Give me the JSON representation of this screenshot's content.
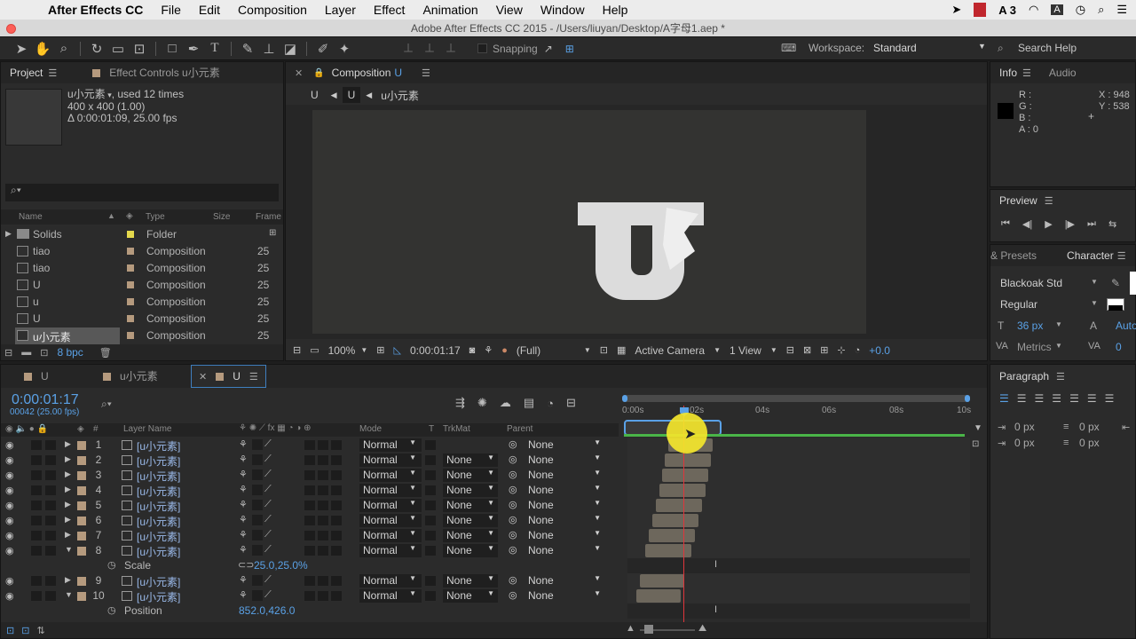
{
  "menubar": {
    "app": "After Effects CC",
    "items": [
      "File",
      "Edit",
      "Composition",
      "Layer",
      "Effect",
      "Animation",
      "View",
      "Window",
      "Help"
    ],
    "status_badge": "3"
  },
  "titlebar": {
    "title": "Adobe After Effects CC 2015 - /Users/liuyan/Desktop/A字母1.aep *"
  },
  "toolbar": {
    "snapping": "Snapping",
    "workspace_label": "Workspace:",
    "workspace_value": "Standard",
    "search_placeholder": "Search Help"
  },
  "project": {
    "tab_project": "Project",
    "tab_effects": "Effect Controls u小元素",
    "item_name": "u小元素",
    "item_used": ", used 12 times",
    "item_dims": "400 x 400 (1.00)",
    "item_duration": "Δ 0:00:01:09, 25.00 fps",
    "cols": {
      "name": "Name",
      "type": "Type",
      "size": "Size",
      "frame": "Frame"
    },
    "rows": [
      {
        "name": "Solids",
        "type": "Folder",
        "frame": "",
        "folder": true
      },
      {
        "name": "tiao",
        "type": "Composition",
        "frame": "25"
      },
      {
        "name": "tiao",
        "type": "Composition",
        "frame": "25"
      },
      {
        "name": "U",
        "type": "Composition",
        "frame": "25"
      },
      {
        "name": "u",
        "type": "Composition",
        "frame": "25"
      },
      {
        "name": "U",
        "type": "Composition",
        "frame": "25"
      },
      {
        "name": "u小元素",
        "type": "Composition",
        "frame": "25",
        "selected": true
      }
    ],
    "bpc": "8 bpc"
  },
  "composition": {
    "tab_label": "Composition",
    "tab_name": "U",
    "crumbs": [
      "U",
      "U",
      "u小元素"
    ],
    "letter": "U",
    "zoom": "100%",
    "timecode": "0:00:01:17",
    "resolution": "(Full)",
    "camera": "Active Camera",
    "views": "1 View",
    "exposure": "+0.0"
  },
  "info": {
    "tab_info": "Info",
    "tab_audio": "Audio",
    "r": "R :",
    "g": "G :",
    "b": "B :",
    "a": "A : 0",
    "x": "X : 948",
    "y": "Y : 538"
  },
  "preview": {
    "title": "Preview"
  },
  "character": {
    "tab_presets": "& Presets",
    "tab_character": "Character",
    "font": "Blackoak Std",
    "style": "Regular",
    "size": "36 px",
    "leading": "Auto",
    "kerning": "Metrics",
    "tracking": "0"
  },
  "paragraph": {
    "title": "Paragraph",
    "indent1": "0 px",
    "indent2": "0 px",
    "indent3": "0 px",
    "space1": "0 px"
  },
  "timeline": {
    "tabs": [
      "U",
      "u小元素",
      "U"
    ],
    "timecode": "0:00:01:17",
    "fps": "00042 (25.00 fps)",
    "cols": {
      "layer_name": "Layer Name",
      "mode": "Mode",
      "t": "T",
      "trkmat": "TrkMat",
      "parent": "Parent"
    },
    "ruler": [
      "0:00s",
      "02s",
      "04s",
      "06s",
      "08s",
      "10s"
    ],
    "layers": [
      {
        "num": "1",
        "name": "[u小元素]",
        "mode": "Normal",
        "trkmat": "",
        "parent": "None",
        "expanded": false
      },
      {
        "num": "2",
        "name": "[u小元素]",
        "mode": "Normal",
        "trkmat": "None",
        "parent": "None",
        "expanded": false
      },
      {
        "num": "3",
        "name": "[u小元素]",
        "mode": "Normal",
        "trkmat": "None",
        "parent": "None",
        "expanded": false
      },
      {
        "num": "4",
        "name": "[u小元素]",
        "mode": "Normal",
        "trkmat": "None",
        "parent": "None",
        "expanded": false
      },
      {
        "num": "5",
        "name": "[u小元素]",
        "mode": "Normal",
        "trkmat": "None",
        "parent": "None",
        "expanded": false
      },
      {
        "num": "6",
        "name": "[u小元素]",
        "mode": "Normal",
        "trkmat": "None",
        "parent": "None",
        "expanded": false
      },
      {
        "num": "7",
        "name": "[u小元素]",
        "mode": "Normal",
        "trkmat": "None",
        "parent": "None",
        "expanded": false
      },
      {
        "num": "8",
        "name": "[u小元素]",
        "mode": "Normal",
        "trkmat": "None",
        "parent": "None",
        "expanded": true
      },
      {
        "prop": "Scale",
        "value": "25.0,25.0%"
      },
      {
        "num": "9",
        "name": "[u小元素]",
        "mode": "Normal",
        "trkmat": "None",
        "parent": "None",
        "expanded": false
      },
      {
        "num": "10",
        "name": "[u小元素]",
        "mode": "Normal",
        "trkmat": "None",
        "parent": "None",
        "expanded": true
      },
      {
        "prop": "Position",
        "value": "852.0,426.0"
      }
    ]
  },
  "colors": {
    "accent": "#5aa1e6",
    "playhead": "#e0353b",
    "cursor_highlight": "#f4e62c"
  }
}
